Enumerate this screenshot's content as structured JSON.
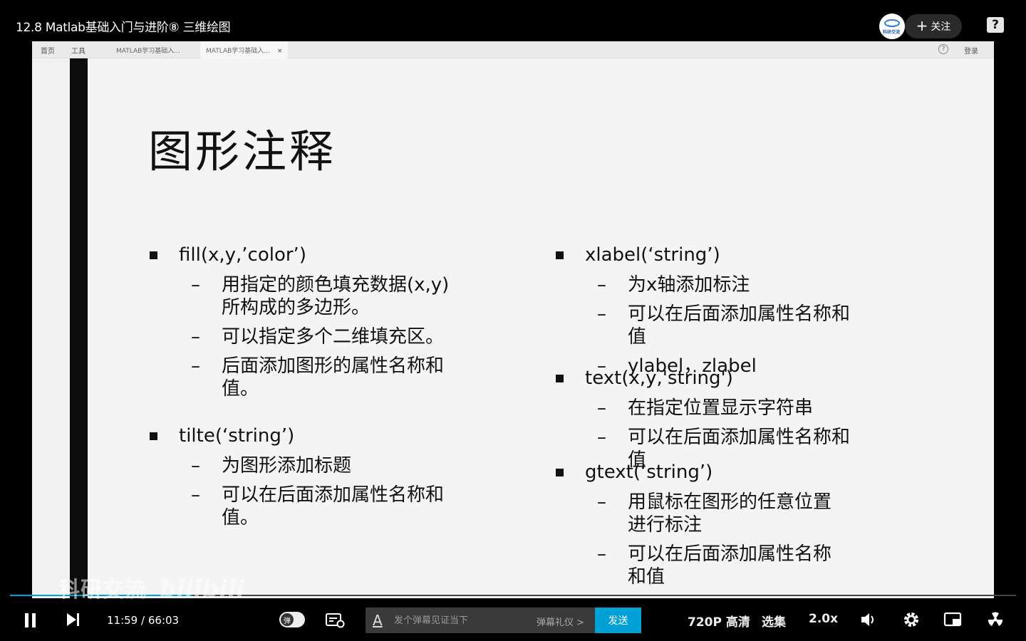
{
  "header": {
    "title": "12.8 Matlab基础入门与进阶⑧ 三维绘图",
    "avatar_label": "科研交流",
    "follow_label": "关注",
    "help_label": "?"
  },
  "app": {
    "toolbar_home": "首页",
    "toolbar_tools": "工具",
    "tabs": [
      "MATLAB学习基础入...",
      "MATLAB学习基础入..."
    ],
    "tab_close": "×",
    "help": "?",
    "login": "登录"
  },
  "slide": {
    "title": "图形注释",
    "left": [
      {
        "head": "fill(x,y,’color’)",
        "subs": [
          "用指定的颜色填充数据(x,y)所构成的多边形。",
          "可以指定多个二维填充区。",
          "后面添加图形的属性名称和值。"
        ]
      },
      {
        "head": "tilte(‘string’)",
        "subs": [
          "为图形添加标题",
          "可以在后面添加属性名称和值。"
        ]
      }
    ],
    "right": [
      {
        "head": "xlabel(‘string’)",
        "subs": [
          "为x轴添加标注",
          "可以在后面添加属性名称和值",
          "ylabel，zlabel"
        ]
      },
      {
        "head": "text(x,y,'string')",
        "subs": [
          "在指定位置显示字符串",
          "可以在后面添加属性名称和值"
        ]
      },
      {
        "head": "gtext(‘string’)",
        "subs": [
          "用鼠标在图形的任意位置进行标注",
          "可以在后面添加属性名称和值"
        ]
      }
    ],
    "dash": "–"
  },
  "watermark": {
    "channel": "科研交流",
    "brand": "bilibili"
  },
  "player": {
    "current_time": "11:59",
    "separator": "/",
    "duration": "66:03",
    "progress_fraction": 0.1816,
    "danmaku_toggle_label": "弹",
    "danmaku_placeholder": "发个弹幕见证当下",
    "danmaku_etiquette": "弹幕礼仪 >",
    "send_label": "发送",
    "quality": "720P 高清",
    "episodes": "选集",
    "speed": "2.0x",
    "accent_color": "#00a1d6"
  }
}
